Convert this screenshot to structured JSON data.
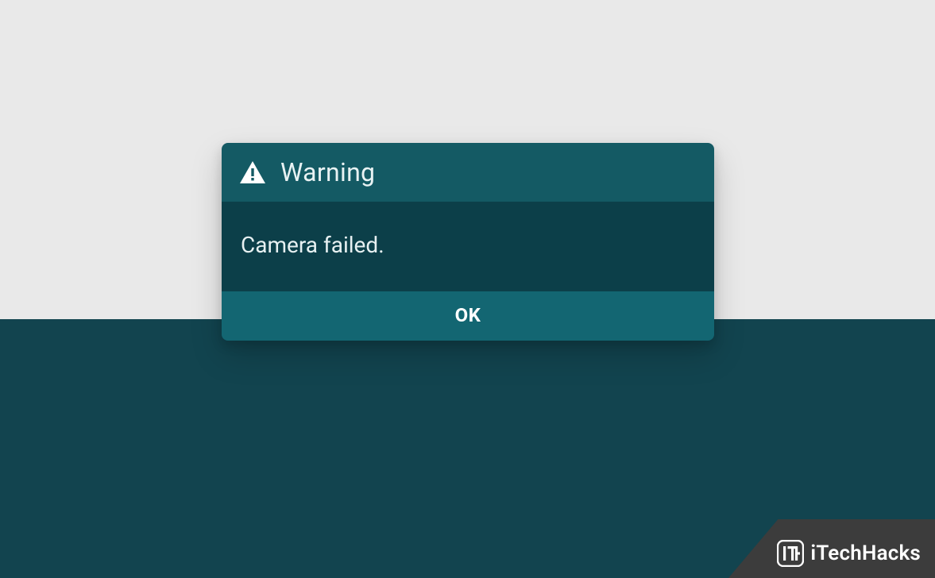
{
  "dialog": {
    "title": "Warning",
    "message": "Camera failed.",
    "ok_label": "OK"
  },
  "watermark": {
    "brand": "iTechHacks"
  }
}
